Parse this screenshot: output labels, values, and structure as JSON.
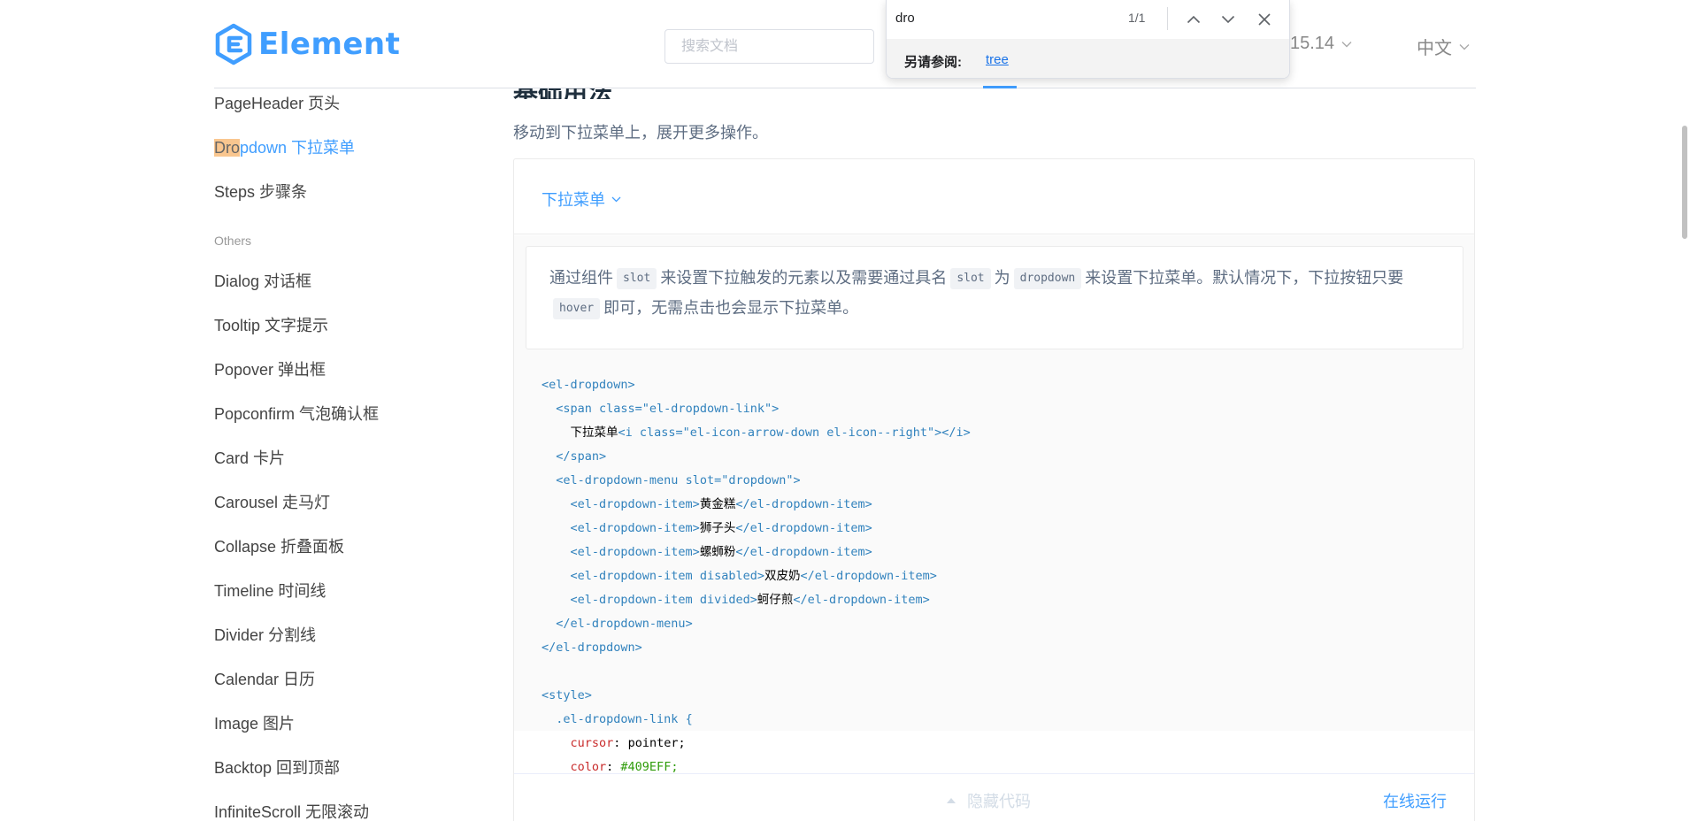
{
  "header": {
    "logo_text": "Element",
    "search_placeholder": "搜索文档",
    "version": "15.14",
    "language": "中文"
  },
  "findbar": {
    "query": "dro",
    "count": "1/1",
    "see_also_label": "另请参阅:",
    "see_also_link": "tree"
  },
  "sidebar": {
    "items_top": [
      "PageHeader 页头"
    ],
    "active_item": {
      "highlight": "Dro",
      "rest": "pdown 下拉菜单"
    },
    "items_mid": [
      "Steps 步骤条"
    ],
    "group_label": "Others",
    "items_others": [
      "Dialog 对话框",
      "Tooltip 文字提示",
      "Popover 弹出框",
      "Popconfirm 气泡确认框",
      "Card 卡片",
      "Carousel 走马灯",
      "Collapse 折叠面板",
      "Timeline 时间线",
      "Divider 分割线",
      "Calendar 日历",
      "Image 图片",
      "Backtop 回到顶部",
      "InfiniteScroll 无限滚动"
    ]
  },
  "main": {
    "section_title": "基础用法",
    "description": "移动到下拉菜单上，展开更多操作。",
    "demo_dropdown_label": "下拉菜单",
    "desc_box": {
      "p1": "通过组件",
      "chip1": "slot",
      "p2": "来设置下拉触发的元素以及需要通过具名",
      "chip2": "slot",
      "p3": "为",
      "chip3": "dropdown",
      "p4": "来设置下拉菜单。默认情况下，下拉按钮只要",
      "chip4": "hover",
      "p5": "即可，无需点击也会显示下拉菜单。"
    },
    "code": {
      "l1": "<el-dropdown>",
      "l2_tag": "<span class=\"el-dropdown-link\">",
      "l3_text": "下拉菜单",
      "l3_tag": "<i class=\"el-icon-arrow-down el-icon--right\"></i>",
      "l4": "</span>",
      "l5": "<el-dropdown-menu slot=\"dropdown\">",
      "item_open": "<el-dropdown-item>",
      "item_open_disabled": "<el-dropdown-item disabled>",
      "item_open_divided": "<el-dropdown-item divided>",
      "item_close": "</el-dropdown-item>",
      "item1": "黄金糕",
      "item2": "狮子头",
      "item3": "螺蛳粉",
      "item4": "双皮奶",
      "item5": "蚵仔煎",
      "l11": "</el-dropdown-menu>",
      "l12": "</el-dropdown>",
      "style_open": "<style>",
      "selector": ".el-dropdown-link {",
      "prop1": "cursor",
      "val1": "pointer;",
      "prop2": "color",
      "val2": "#409EFF;"
    },
    "hide_code": "隐藏代码",
    "run_online": "在线运行"
  },
  "colors": {
    "primary": "#409eff",
    "find_highlight": "#f9c68f"
  }
}
